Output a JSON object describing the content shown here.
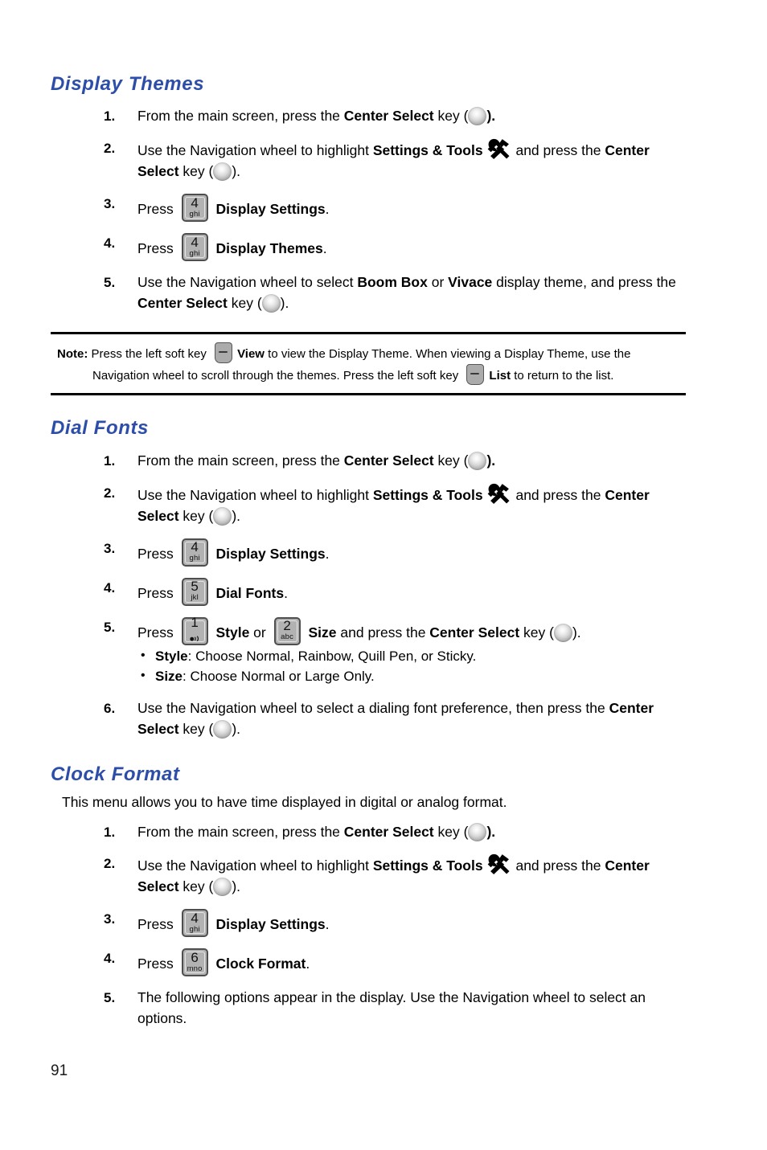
{
  "page": {
    "number": "91",
    "heading_color": "#2d4ea8"
  },
  "icons": {
    "center_select": "center-select-key-icon",
    "settings_tools": "hammer-wrench-icon",
    "soft_key": "left-soft-key-icon"
  },
  "sections": [
    {
      "id": "display-themes",
      "heading": "Display Themes",
      "steps": [
        {
          "num": "1.",
          "parts": [
            {
              "t": "text",
              "v": "From the main screen, press the "
            },
            {
              "t": "bold",
              "v": "Center Select"
            },
            {
              "t": "text",
              "v": " key ("
            },
            {
              "t": "cskey"
            },
            {
              "t": "bold",
              "v": ")."
            }
          ]
        },
        {
          "num": "2.",
          "parts": [
            {
              "t": "text",
              "v": "Use the Navigation wheel to highlight "
            },
            {
              "t": "bold",
              "v": "Settings & Tools"
            },
            {
              "t": "tools"
            },
            {
              "t": "text",
              "v": " and press the "
            },
            {
              "t": "bold",
              "v": "Center Select"
            },
            {
              "t": "text",
              "v": " key ("
            },
            {
              "t": "cskey"
            },
            {
              "t": "text",
              "v": ")."
            }
          ]
        },
        {
          "num": "3.",
          "parts": [
            {
              "t": "text",
              "v": "Press "
            },
            {
              "t": "key",
              "digit": "4",
              "letters": "ghi"
            },
            {
              "t": "text",
              "v": " "
            },
            {
              "t": "bold",
              "v": "Display Settings"
            },
            {
              "t": "text",
              "v": "."
            }
          ]
        },
        {
          "num": "4.",
          "parts": [
            {
              "t": "text",
              "v": "Press "
            },
            {
              "t": "key",
              "digit": "4",
              "letters": "ghi"
            },
            {
              "t": "text",
              "v": " "
            },
            {
              "t": "bold",
              "v": "Display Themes"
            },
            {
              "t": "text",
              "v": "."
            }
          ]
        },
        {
          "num": "5.",
          "parts": [
            {
              "t": "text",
              "v": "Use the Navigation wheel to select "
            },
            {
              "t": "bold",
              "v": "Boom Box"
            },
            {
              "t": "text",
              "v": " or "
            },
            {
              "t": "bold",
              "v": "Vivace"
            },
            {
              "t": "text",
              "v": " display theme, and press the "
            },
            {
              "t": "bold",
              "v": "Center Select"
            },
            {
              "t": "text",
              "v": " key ("
            },
            {
              "t": "cskey"
            },
            {
              "t": "text",
              "v": ")."
            }
          ]
        }
      ]
    },
    {
      "id": "dial-fonts",
      "heading": "Dial Fonts",
      "steps": [
        {
          "num": "1.",
          "parts": [
            {
              "t": "text",
              "v": "From the main screen, press the "
            },
            {
              "t": "bold",
              "v": "Center Select"
            },
            {
              "t": "text",
              "v": " key ("
            },
            {
              "t": "cskey"
            },
            {
              "t": "bold",
              "v": ")."
            }
          ]
        },
        {
          "num": "2.",
          "parts": [
            {
              "t": "text",
              "v": "Use the Navigation wheel to highlight "
            },
            {
              "t": "bold",
              "v": "Settings & Tools"
            },
            {
              "t": "tools"
            },
            {
              "t": "text",
              "v": " and press the "
            },
            {
              "t": "bold",
              "v": "Center Select"
            },
            {
              "t": "text",
              "v": " key ("
            },
            {
              "t": "cskey"
            },
            {
              "t": "text",
              "v": ")."
            }
          ]
        },
        {
          "num": "3.",
          "parts": [
            {
              "t": "text",
              "v": "Press "
            },
            {
              "t": "key",
              "digit": "4",
              "letters": "ghi"
            },
            {
              "t": "text",
              "v": " "
            },
            {
              "t": "bold",
              "v": "Display Settings"
            },
            {
              "t": "text",
              "v": "."
            }
          ]
        },
        {
          "num": "4.",
          "parts": [
            {
              "t": "text",
              "v": "Press "
            },
            {
              "t": "key",
              "digit": "5",
              "letters": "jkl"
            },
            {
              "t": "text",
              "v": " "
            },
            {
              "t": "bold",
              "v": "Dial Fonts"
            },
            {
              "t": "text",
              "v": "."
            }
          ]
        },
        {
          "num": "5.",
          "parts": [
            {
              "t": "text",
              "v": "Press "
            },
            {
              "t": "key",
              "digit": "1",
              "letters": "voicemail"
            },
            {
              "t": "text",
              "v": " "
            },
            {
              "t": "bold",
              "v": "Style"
            },
            {
              "t": "text",
              "v": " or "
            },
            {
              "t": "key",
              "digit": "2",
              "letters": "abc"
            },
            {
              "t": "text",
              "v": " "
            },
            {
              "t": "bold",
              "v": "Size"
            },
            {
              "t": "text",
              "v": " and press the "
            },
            {
              "t": "bold",
              "v": "Center Select"
            },
            {
              "t": "text",
              "v": " key ("
            },
            {
              "t": "cskey"
            },
            {
              "t": "text",
              "v": ")."
            }
          ],
          "sub": [
            [
              {
                "t": "bold",
                "v": "Style"
              },
              {
                "t": "text",
                "v": ": Choose Normal, Rainbow, Quill Pen, or Sticky."
              }
            ],
            [
              {
                "t": "bold",
                "v": "Size"
              },
              {
                "t": "text",
                "v": ": Choose Normal or Large Only."
              }
            ]
          ]
        },
        {
          "num": "6.",
          "parts": [
            {
              "t": "text",
              "v": "Use the Navigation wheel to select a dialing font preference, then press the "
            },
            {
              "t": "bold",
              "v": "Center Select"
            },
            {
              "t": "text",
              "v": " key ("
            },
            {
              "t": "cskey"
            },
            {
              "t": "text",
              "v": ")."
            }
          ]
        }
      ]
    },
    {
      "id": "clock-format",
      "heading": "Clock Format",
      "intro": "This menu allows you to have time displayed in digital or analog format.",
      "steps": [
        {
          "num": "1.",
          "parts": [
            {
              "t": "text",
              "v": "From the main screen, press the "
            },
            {
              "t": "bold",
              "v": "Center Select"
            },
            {
              "t": "text",
              "v": " key ("
            },
            {
              "t": "cskey"
            },
            {
              "t": "bold",
              "v": ")."
            }
          ]
        },
        {
          "num": "2.",
          "parts": [
            {
              "t": "text",
              "v": "Use the Navigation wheel to highlight "
            },
            {
              "t": "bold",
              "v": "Settings & Tools"
            },
            {
              "t": "tools"
            },
            {
              "t": "text",
              "v": " and press the "
            },
            {
              "t": "bold",
              "v": "Center Select"
            },
            {
              "t": "text",
              "v": " key ("
            },
            {
              "t": "cskey"
            },
            {
              "t": "text",
              "v": ")."
            }
          ]
        },
        {
          "num": "3.",
          "parts": [
            {
              "t": "text",
              "v": "Press "
            },
            {
              "t": "key",
              "digit": "4",
              "letters": "ghi"
            },
            {
              "t": "text",
              "v": " "
            },
            {
              "t": "bold",
              "v": "Display Settings"
            },
            {
              "t": "text",
              "v": "."
            }
          ]
        },
        {
          "num": "4.",
          "parts": [
            {
              "t": "text",
              "v": "Press "
            },
            {
              "t": "key",
              "digit": "6",
              "letters": "mno"
            },
            {
              "t": "text",
              "v": " "
            },
            {
              "t": "bold",
              "v": "Clock Format"
            },
            {
              "t": "text",
              "v": "."
            }
          ]
        },
        {
          "num": "5.",
          "parts": [
            {
              "t": "text",
              "v": "The following options appear in the display. Use the Navigation wheel to select an options."
            }
          ]
        }
      ]
    }
  ],
  "note": {
    "label": "Note:",
    "parts": [
      {
        "t": "text",
        "v": " Press the left soft key "
      },
      {
        "t": "softkey"
      },
      {
        "t": "bold",
        "v": "View"
      },
      {
        "t": "text",
        "v": " to view the Display Theme. When viewing a Display Theme, use the Navigation wheel to scroll through the themes. Press the left soft key "
      },
      {
        "t": "softkey"
      },
      {
        "t": "bold",
        "v": "List"
      },
      {
        "t": "text",
        "v": " to return to the list."
      }
    ]
  }
}
